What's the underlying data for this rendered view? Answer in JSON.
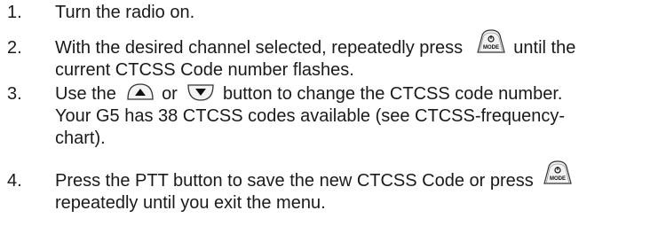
{
  "steps": [
    {
      "number": "1.",
      "text": "Turn the radio on."
    },
    {
      "number": "2.",
      "line1_pre": "With the desired channel selected, repeatedly press",
      "line1_post": "until the",
      "line2": "current CTCSS Code number flashes."
    },
    {
      "number": "3.",
      "line1_a": "Use the",
      "line1_b": "or",
      "line1_c": "button to change the CTCSS code number.",
      "line2": "Your G5 has 38 CTCSS codes available (see CTCSS-frequency-",
      "line3": "chart)."
    },
    {
      "number": "4.",
      "line1_pre": "Press the PTT button to save the new CTCSS Code or press",
      "line2": "repeatedly until you exit the menu."
    }
  ],
  "icons": {
    "mode_key_label": "MODE",
    "up_key": "up-arrow-key-icon",
    "down_key": "down-arrow-key-icon"
  }
}
